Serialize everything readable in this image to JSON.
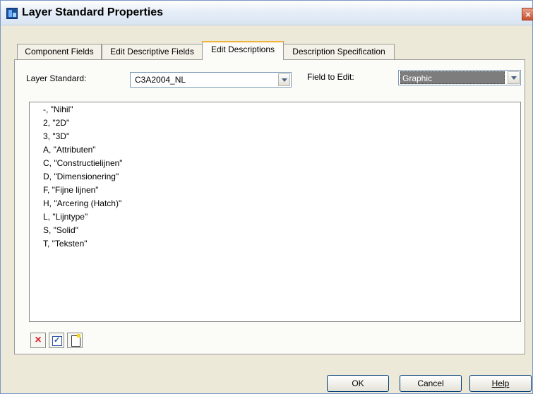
{
  "window": {
    "title": "Layer Standard Properties",
    "close_glyph": "×"
  },
  "tabs": [
    {
      "label": "Component Fields",
      "active": false
    },
    {
      "label": "Edit Descriptive Fields",
      "active": false
    },
    {
      "label": "Edit Descriptions",
      "active": true
    },
    {
      "label": "Description Specification",
      "active": false
    }
  ],
  "form": {
    "layer_standard_label": "Layer Standard:",
    "layer_standard_value": "C3A2004_NL",
    "field_to_edit_label": "Field to Edit:",
    "field_to_edit_value": "Graphic"
  },
  "descriptions": [
    "-, \"Nihil\"",
    "2, \"2D\"",
    "3, \"3D\"",
    "A, \"Attributen\"",
    "C, \"Constructielijnen\"",
    "D, \"Dimensionering\"",
    "F, \"Fijne lijnen\"",
    "H, \"Arcering (Hatch)\"",
    "L, \"Lijntype\"",
    "S, \"Solid\"",
    "T, \"Teksten\""
  ],
  "toolbar": {
    "delete_icon": "delete-icon",
    "edit_icon": "edit-icon",
    "new_icon": "new-icon",
    "delete_glyph": "×"
  },
  "buttons": {
    "ok": "OK",
    "cancel": "Cancel",
    "help": "Help"
  },
  "colors": {
    "tab_highlight": "#f0b23a",
    "delete_red": "#e0222a",
    "selection_gray": "#7d7d7d"
  }
}
